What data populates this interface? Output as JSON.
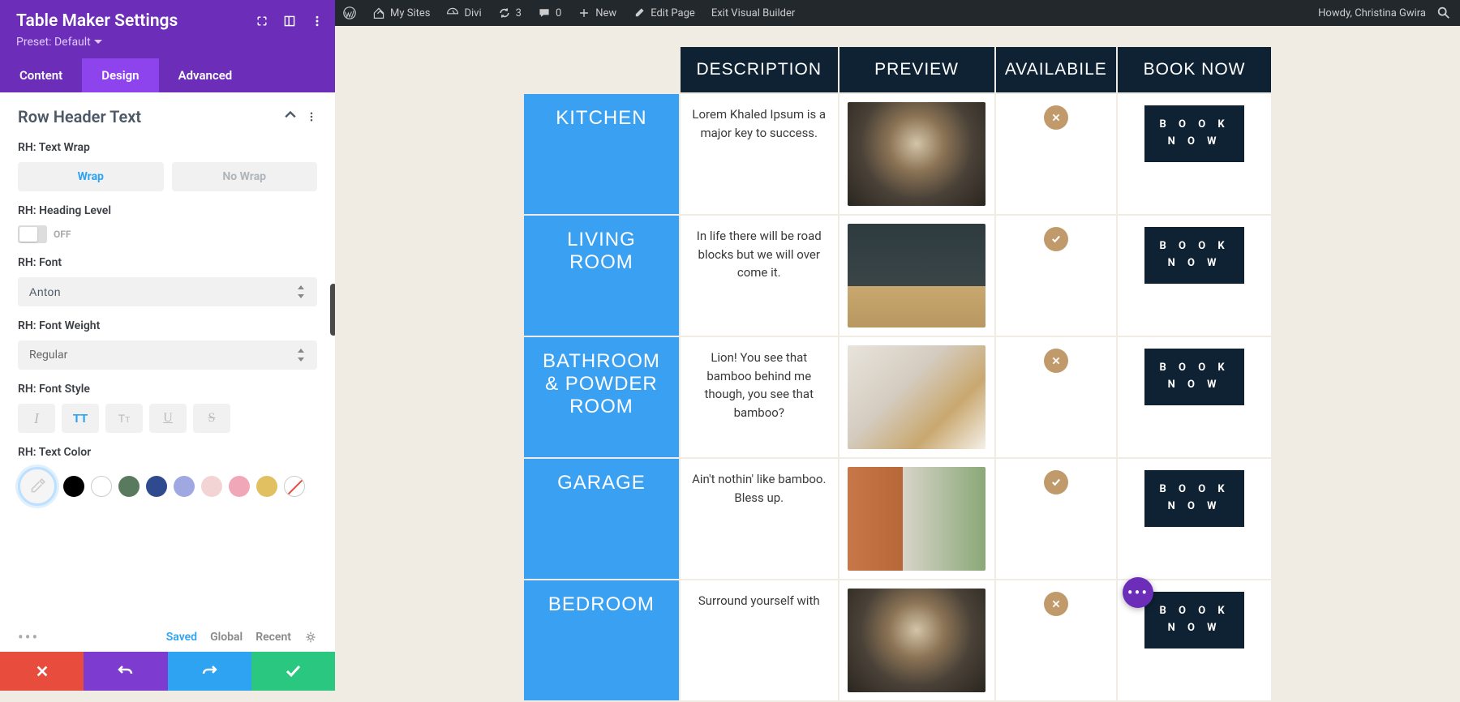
{
  "admin_bar": {
    "my_sites": "My Sites",
    "divi": "Divi",
    "refresh_count": "3",
    "comments_count": "0",
    "new": "New",
    "edit_page": "Edit Page",
    "exit_vb": "Exit Visual Builder",
    "howdy": "Howdy, Christina Gwira"
  },
  "panel": {
    "title": "Table Maker Settings",
    "preset": "Preset: Default",
    "tabs": {
      "content": "Content",
      "design": "Design",
      "advanced": "Advanced"
    },
    "section": "Row Header Text",
    "fields": {
      "text_wrap_label": "RH: Text Wrap",
      "wrap": "Wrap",
      "no_wrap": "No Wrap",
      "heading_level_label": "RH: Heading Level",
      "heading_level_state": "OFF",
      "font_label": "RH: Font",
      "font_value": "Anton",
      "font_weight_label": "RH: Font Weight",
      "font_weight_value": "Regular",
      "font_style_label": "RH: Font Style",
      "text_color_label": "RH: Text Color"
    },
    "footer": {
      "saved": "Saved",
      "global": "Global",
      "recent": "Recent"
    },
    "colors": [
      "#000000",
      "#ffffff",
      "#5a7a5f",
      "#2f4a8f",
      "#9fa8e0",
      "#f3d4d4",
      "#f0a8b8",
      "#e0c060"
    ]
  },
  "table": {
    "headers": {
      "description": "DESCRIPTION",
      "preview": "PREVIEW",
      "available": "AVAILABILE",
      "book_now": "BOOK NOW"
    },
    "book_label": "BOOK NOW",
    "rows": [
      {
        "name": "KITCHEN",
        "desc": "Lorem Khaled Ipsum is a major key to success.",
        "available": false
      },
      {
        "name": "LIVING ROOM",
        "desc": "In life there will be road blocks but we will over come it.",
        "available": true
      },
      {
        "name": "BATHROOM & POWDER ROOM",
        "desc": "Lion! You see that bamboo behind me though, you see that bamboo?",
        "available": false
      },
      {
        "name": "GARAGE",
        "desc": "Ain't nothin' like bamboo. Bless up.",
        "available": true
      },
      {
        "name": "BEDROOM",
        "desc": "Surround yourself with",
        "available": false
      }
    ]
  }
}
